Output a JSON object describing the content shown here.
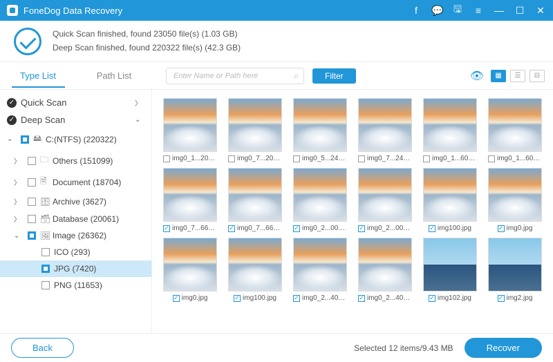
{
  "app_title": "FoneDog Data Recovery",
  "status": {
    "line1": "Quick Scan finished, found 23050 file(s) (1.03 GB)",
    "line2": "Deep Scan finished, found 220322 file(s) (42.3 GB)"
  },
  "tabs": {
    "type_list": "Type List",
    "path_list": "Path List"
  },
  "search": {
    "placeholder": "Enter Name or Path here"
  },
  "filter_label": "Filter",
  "tree": {
    "quick_scan": "Quick Scan",
    "deep_scan": "Deep Scan",
    "drive": "C:(NTFS) (220322)",
    "others": "Others (151099)",
    "document": "Document (18704)",
    "archive": "Archive (3627)",
    "database": "Database (20061)",
    "image": "Image (26362)",
    "ico": "ICO (293)",
    "jpg": "JPG (7420)",
    "png": "PNG (11653)"
  },
  "thumbs": [
    {
      "name": "img0_1...20.jpg",
      "checked": false,
      "alt": false
    },
    {
      "name": "img0_7...20.jpg",
      "checked": false,
      "alt": false
    },
    {
      "name": "img0_5...24.jpg",
      "checked": false,
      "alt": false
    },
    {
      "name": "img0_7...24.jpg",
      "checked": false,
      "alt": false
    },
    {
      "name": "img0_1...60.jpg",
      "checked": false,
      "alt": false
    },
    {
      "name": "img0_1...60.jpg",
      "checked": false,
      "alt": false
    },
    {
      "name": "img0_7...66.jpg",
      "checked": true,
      "alt": false
    },
    {
      "name": "img0_7...66.jpg",
      "checked": true,
      "alt": false
    },
    {
      "name": "img0_2...00.jpg",
      "checked": true,
      "alt": false
    },
    {
      "name": "img0_2...00.jpg",
      "checked": true,
      "alt": false
    },
    {
      "name": "img100.jpg",
      "checked": true,
      "alt": false
    },
    {
      "name": "img0.jpg",
      "checked": true,
      "alt": false
    },
    {
      "name": "img0.jpg",
      "checked": true,
      "alt": false
    },
    {
      "name": "img100.jpg",
      "checked": true,
      "alt": false
    },
    {
      "name": "img0_2...40.jpg",
      "checked": true,
      "alt": false
    },
    {
      "name": "img0_2...40.jpg",
      "checked": true,
      "alt": false
    },
    {
      "name": "img102.jpg",
      "checked": true,
      "alt": true
    },
    {
      "name": "img2.jpg",
      "checked": true,
      "alt": true
    }
  ],
  "footer": {
    "back": "Back",
    "status": "Selected 12 items/9.43 MB",
    "recover": "Recover"
  }
}
